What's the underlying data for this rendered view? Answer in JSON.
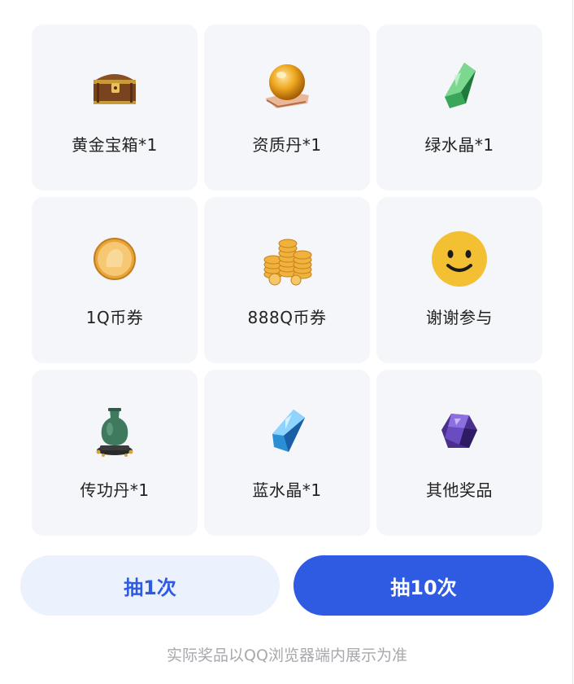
{
  "prizes": [
    {
      "label": "黄金宝箱*1",
      "icon": "treasure-chest-icon"
    },
    {
      "label": "资质丹*1",
      "icon": "golden-pill-icon"
    },
    {
      "label": "绿水晶*1",
      "icon": "green-crystal-icon"
    },
    {
      "label": "1Q币券",
      "icon": "gold-coin-icon"
    },
    {
      "label": "888Q币券",
      "icon": "coin-pile-icon"
    },
    {
      "label": "谢谢参与",
      "icon": "smiley-icon"
    },
    {
      "label": "传功丹*1",
      "icon": "jade-vase-icon"
    },
    {
      "label": "蓝水晶*1",
      "icon": "blue-crystal-icon"
    },
    {
      "label": "其他奖品",
      "icon": "purple-gem-icon"
    }
  ],
  "buttons": {
    "draw_once": "抽1次",
    "draw_ten": "抽10次"
  },
  "footer": {
    "note": "实际奖品以QQ浏览器端内展示为准"
  },
  "colors": {
    "accent": "#2f5be3",
    "accent_light": "#ebf1fd",
    "card_bg": "#f5f6fa",
    "smiley": "#f3c034"
  }
}
